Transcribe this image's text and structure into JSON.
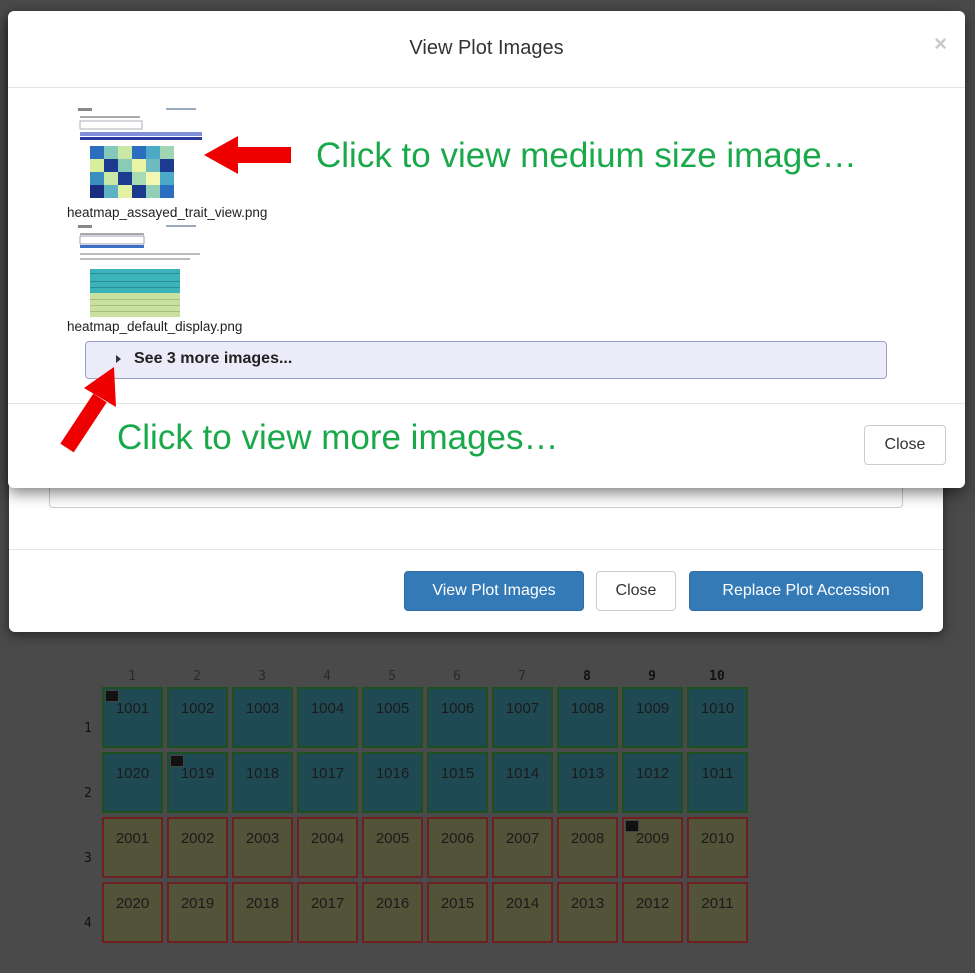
{
  "front_modal": {
    "title": "View Plot Images",
    "close_x": "×",
    "images": [
      {
        "filename": "heatmap_assayed_trait_view.png"
      },
      {
        "filename": "heatmap_default_display.png"
      }
    ],
    "more_images_label": "See 3 more images...",
    "close_button": "Close"
  },
  "back_modal": {
    "view_images_button": "View Plot Images",
    "close_button": "Close",
    "replace_button": "Replace Plot Accession"
  },
  "annotations": {
    "medium_image": "Click to view medium size image…",
    "more_images": "Click to view more images…"
  },
  "grid": {
    "column_numbers": [
      "1",
      "2",
      "3",
      "4",
      "5",
      "6",
      "7",
      "8",
      "9",
      "10"
    ],
    "row_numbers": [
      "1",
      "2",
      "3",
      "4"
    ],
    "rows": [
      [
        "1001",
        "1002",
        "1003",
        "1004",
        "1005",
        "1006",
        "1007",
        "1008",
        "1009",
        "1010"
      ],
      [
        "1020",
        "1019",
        "1018",
        "1017",
        "1016",
        "1015",
        "1014",
        "1013",
        "1012",
        "1011"
      ],
      [
        "2001",
        "2002",
        "2003",
        "2004",
        "2005",
        "2006",
        "2007",
        "2008",
        "2009",
        "2010"
      ],
      [
        "2020",
        "2019",
        "2018",
        "2017",
        "2016",
        "2015",
        "2014",
        "2013",
        "2012",
        "2011"
      ]
    ],
    "colors": {
      "blue_cell": "#1f4a54",
      "olive_cell": "#525339",
      "arrow": "#ee0000",
      "annotation_text": "#19a94b"
    }
  }
}
